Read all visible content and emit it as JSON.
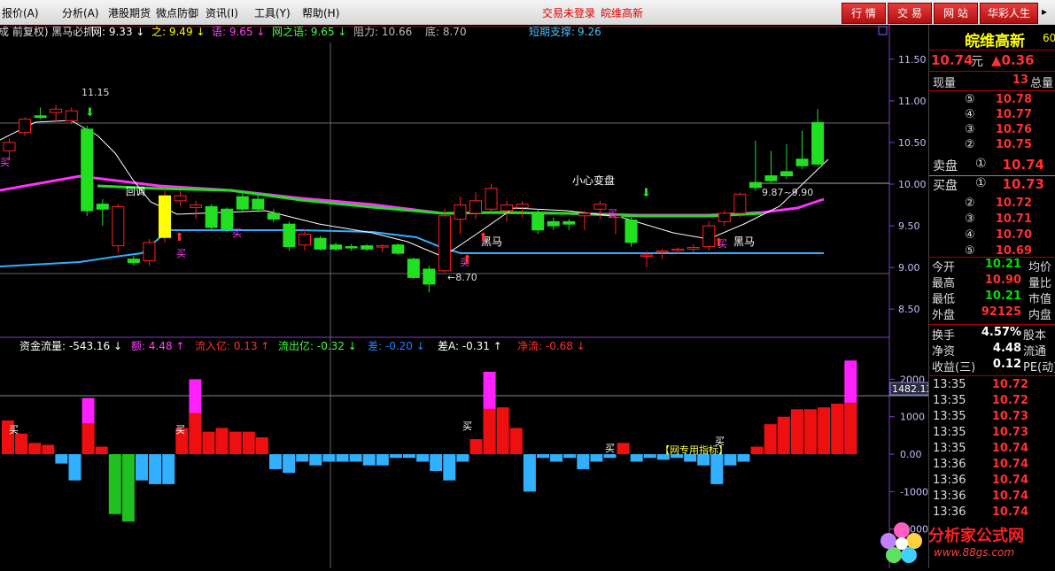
{
  "menu": {
    "items": [
      "报价(A)",
      "分析(A)",
      "港股期货",
      "微点防御",
      "资讯(I)",
      "工具(Y)",
      "帮助(H)"
    ],
    "status": "交易未登录",
    "stock_name_top": "皖维高新",
    "buttons": [
      "行 情",
      "交 易",
      "网 站",
      "华彩人生"
    ]
  },
  "chart": {
    "header": {
      "prefix": "成 前复权) 黑马必抓",
      "items": [
        {
          "label": "网:",
          "value": "9.33",
          "arrow": "↓",
          "color": "#ffffff"
        },
        {
          "label": "之:",
          "value": "9.49",
          "arrow": "↓",
          "color": "#ffff00"
        },
        {
          "label": "语:",
          "value": "9.65",
          "arrow": "↓",
          "color": "#ff40ff"
        },
        {
          "label": "网之语:",
          "value": "9.65",
          "arrow": "↓",
          "color": "#40ff40"
        },
        {
          "label": "阻力:",
          "value": "10.66",
          "arrow": "",
          "color": "#bbbbbb"
        },
        {
          "label": "底:",
          "value": "8.70",
          "arrow": "",
          "color": "#bbbbbb"
        }
      ],
      "support_label": "短期支撑:",
      "support_value": "9.26"
    },
    "annotations": {
      "high": "11.15",
      "low": "←8.70",
      "warn": "小心变盘",
      "zone": "9.87~9.90",
      "buy": "买",
      "dark_horse": "黑马",
      "callback": "回调",
      "band_label": "【网专用指标】"
    },
    "y_axis_labels": [
      "11.50",
      "11.00",
      "10.50",
      "10.00",
      "9.50",
      "9.00",
      "8.50"
    ],
    "lower": {
      "items": [
        {
          "label": "资金流量:",
          "value": "-543.16",
          "arrow": "↓",
          "color": "#ffffff"
        },
        {
          "label": "额:",
          "value": "4.48",
          "arrow": "↑",
          "color": "#ff40ff"
        },
        {
          "label": "流入亿:",
          "value": "0.13",
          "arrow": "↑",
          "color": "#ff3030"
        },
        {
          "label": "流出亿:",
          "value": "-0.32",
          "arrow": "↓",
          "color": "#40ff40"
        },
        {
          "label": "差:",
          "value": "-0.20",
          "arrow": "↓",
          "color": "#2080ff"
        },
        {
          "label": "差A:",
          "value": "-0.31",
          "arrow": "↑",
          "color": "#ffffff"
        },
        {
          "label": "净流:",
          "value": "-0.68",
          "arrow": "↓",
          "color": "#ff3030"
        }
      ],
      "y_axis_labels": [
        "2000",
        "1000",
        "0.00",
        "-1000",
        "-2000"
      ],
      "marker": "1482.13"
    }
  },
  "panel": {
    "name": "皖维高新",
    "code_fragment": "60",
    "price": "10.74",
    "unit": "元",
    "change": "▲0.36",
    "vol_label": "现量",
    "vol_value": "13",
    "total_label": "总量",
    "sell_label": "卖盘",
    "buy_label": "买盘",
    "sells": [
      {
        "n": "⑤",
        "p": "10.78"
      },
      {
        "n": "④",
        "p": "10.77"
      },
      {
        "n": "③",
        "p": "10.76"
      },
      {
        "n": "②",
        "p": "10.75"
      },
      {
        "n": "①",
        "p": "10.74"
      }
    ],
    "buys": [
      {
        "n": "①",
        "p": "10.73"
      },
      {
        "n": "②",
        "p": "10.72"
      },
      {
        "n": "③",
        "p": "10.71"
      },
      {
        "n": "④",
        "p": "10.70"
      },
      {
        "n": "⑤",
        "p": "10.69"
      }
    ],
    "stats": [
      {
        "l": "今开",
        "v": "10.21",
        "c": "green",
        "r": "均价"
      },
      {
        "l": "最高",
        "v": "10.90",
        "c": "red",
        "r": "量比"
      },
      {
        "l": "最低",
        "v": "10.21",
        "c": "green",
        "r": "市值"
      },
      {
        "l": "外盘",
        "v": "92125",
        "c": "red",
        "r": "内盘"
      }
    ],
    "stats2": [
      {
        "l": "换手",
        "v": "4.57%",
        "r": "股本"
      },
      {
        "l": "净资",
        "v": "4.48",
        "r": "流通"
      },
      {
        "l": "收益(三)",
        "v": "0.12",
        "r": "PE(动)"
      }
    ],
    "ticks": [
      {
        "t": "13:35",
        "p": "10.72"
      },
      {
        "t": "13:35",
        "p": "10.72"
      },
      {
        "t": "13:35",
        "p": "10.73"
      },
      {
        "t": "13:35",
        "p": "10.73"
      },
      {
        "t": "13:35",
        "p": "10.74"
      },
      {
        "t": "13:36",
        "p": "10.74"
      },
      {
        "t": "13:36",
        "p": "10.74"
      },
      {
        "t": "13:36",
        "p": "10.74"
      },
      {
        "t": "13:36",
        "p": "10.74"
      }
    ]
  },
  "watermark": {
    "name": "分析家公式网",
    "url": "www.88gs.com"
  },
  "chart_data": {
    "type": "candlestick",
    "ylim": [
      8.3,
      11.7
    ],
    "candles": [
      {
        "o": 10.4,
        "h": 10.55,
        "l": 10.28,
        "c": 10.5
      },
      {
        "o": 10.62,
        "h": 10.8,
        "l": 10.58,
        "c": 10.78
      },
      {
        "o": 10.82,
        "h": 10.92,
        "l": 10.78,
        "c": 10.8
      },
      {
        "o": 10.86,
        "h": 10.95,
        "l": 10.75,
        "c": 10.9
      },
      {
        "o": 10.76,
        "h": 10.92,
        "l": 10.72,
        "c": 10.88
      },
      {
        "o": 10.66,
        "h": 10.7,
        "l": 9.62,
        "c": 9.68
      },
      {
        "o": 9.76,
        "h": 9.82,
        "l": 9.5,
        "c": 9.7
      },
      {
        "o": 9.26,
        "h": 9.76,
        "l": 9.18,
        "c": 9.73
      },
      {
        "o": 9.1,
        "h": 9.14,
        "l": 9.02,
        "c": 9.06
      },
      {
        "o": 9.08,
        "h": 9.34,
        "l": 9.02,
        "c": 9.3
      },
      {
        "o": 9.36,
        "h": 9.95,
        "l": 9.3,
        "c": 9.86
      },
      {
        "o": 9.8,
        "h": 9.92,
        "l": 9.74,
        "c": 9.86
      },
      {
        "o": 9.72,
        "h": 9.8,
        "l": 9.58,
        "c": 9.75
      },
      {
        "o": 9.73,
        "h": 9.76,
        "l": 9.45,
        "c": 9.48
      },
      {
        "o": 9.7,
        "h": 9.72,
        "l": 9.42,
        "c": 9.46
      },
      {
        "o": 9.85,
        "h": 9.9,
        "l": 9.66,
        "c": 9.7
      },
      {
        "o": 9.82,
        "h": 9.88,
        "l": 9.66,
        "c": 9.7
      },
      {
        "o": 9.65,
        "h": 9.7,
        "l": 9.54,
        "c": 9.58
      },
      {
        "o": 9.52,
        "h": 9.55,
        "l": 9.2,
        "c": 9.25
      },
      {
        "o": 9.27,
        "h": 9.46,
        "l": 9.2,
        "c": 9.4
      },
      {
        "o": 9.35,
        "h": 9.38,
        "l": 9.2,
        "c": 9.22
      },
      {
        "o": 9.27,
        "h": 9.3,
        "l": 9.2,
        "c": 9.22
      },
      {
        "o": 9.25,
        "h": 9.28,
        "l": 9.2,
        "c": 9.24
      },
      {
        "o": 9.26,
        "h": 9.28,
        "l": 9.2,
        "c": 9.22
      },
      {
        "o": 9.25,
        "h": 9.28,
        "l": 9.18,
        "c": 9.26
      },
      {
        "o": 9.27,
        "h": 9.29,
        "l": 9.15,
        "c": 9.17
      },
      {
        "o": 9.1,
        "h": 9.12,
        "l": 8.86,
        "c": 8.88
      },
      {
        "o": 8.98,
        "h": 9.02,
        "l": 8.7,
        "c": 8.8
      },
      {
        "o": 8.96,
        "h": 9.7,
        "l": 8.94,
        "c": 9.62
      },
      {
        "o": 9.58,
        "h": 9.85,
        "l": 9.4,
        "c": 9.75
      },
      {
        "o": 9.65,
        "h": 9.9,
        "l": 9.58,
        "c": 9.8
      },
      {
        "o": 9.7,
        "h": 10.0,
        "l": 9.66,
        "c": 9.95
      },
      {
        "o": 9.68,
        "h": 9.8,
        "l": 9.55,
        "c": 9.75
      },
      {
        "o": 9.72,
        "h": 9.8,
        "l": 9.6,
        "c": 9.76
      },
      {
        "o": 9.65,
        "h": 9.7,
        "l": 9.4,
        "c": 9.45
      },
      {
        "o": 9.55,
        "h": 9.6,
        "l": 9.45,
        "c": 9.5
      },
      {
        "o": 9.55,
        "h": 9.58,
        "l": 9.45,
        "c": 9.52
      },
      {
        "o": 9.62,
        "h": 9.68,
        "l": 9.45,
        "c": 9.65
      },
      {
        "o": 9.7,
        "h": 9.8,
        "l": 9.58,
        "c": 9.76
      },
      {
        "o": 9.6,
        "h": 9.66,
        "l": 9.4,
        "c": 9.62
      },
      {
        "o": 9.57,
        "h": 9.6,
        "l": 9.25,
        "c": 9.3
      },
      {
        "o": 9.15,
        "h": 9.2,
        "l": 9.0,
        "c": 9.15
      },
      {
        "o": 9.19,
        "h": 9.22,
        "l": 9.1,
        "c": 9.2
      },
      {
        "o": 9.21,
        "h": 9.24,
        "l": 9.16,
        "c": 9.22
      },
      {
        "o": 9.22,
        "h": 9.28,
        "l": 9.18,
        "c": 9.24
      },
      {
        "o": 9.25,
        "h": 9.55,
        "l": 9.2,
        "c": 9.5
      },
      {
        "o": 9.55,
        "h": 9.68,
        "l": 9.5,
        "c": 9.65
      },
      {
        "o": 9.65,
        "h": 9.9,
        "l": 9.6,
        "c": 9.88
      },
      {
        "o": 10.02,
        "h": 10.52,
        "l": 9.92,
        "c": 9.96
      },
      {
        "o": 10.1,
        "h": 10.4,
        "l": 10.02,
        "c": 10.04
      },
      {
        "o": 10.15,
        "h": 10.48,
        "l": 10.06,
        "c": 10.1
      },
      {
        "o": 10.3,
        "h": 10.64,
        "l": 10.18,
        "c": 10.22
      },
      {
        "o": 10.74,
        "h": 10.9,
        "l": 10.21,
        "c": 10.24
      }
    ],
    "money_flow": {
      "ylim": [
        -3000,
        2600
      ],
      "values": [
        900,
        550,
        300,
        250,
        -250,
        -700,
        1500,
        200,
        -1600,
        -1800,
        -700,
        -800,
        -800,
        700,
        2000,
        600,
        700,
        600,
        600,
        450,
        -400,
        -500,
        -200,
        -300,
        -200,
        -200,
        -200,
        -300,
        -300,
        -100,
        -100,
        -200,
        -450,
        -700,
        -200,
        400,
        2200,
        1250,
        700,
        -1000,
        -100,
        -200,
        -100,
        -400,
        -200,
        -100,
        300,
        -200,
        -100,
        -150,
        -100,
        -200,
        -300,
        -800,
        -300,
        -200,
        200,
        800,
        1000,
        1200,
        1200,
        1250,
        1350,
        2500
      ]
    }
  }
}
